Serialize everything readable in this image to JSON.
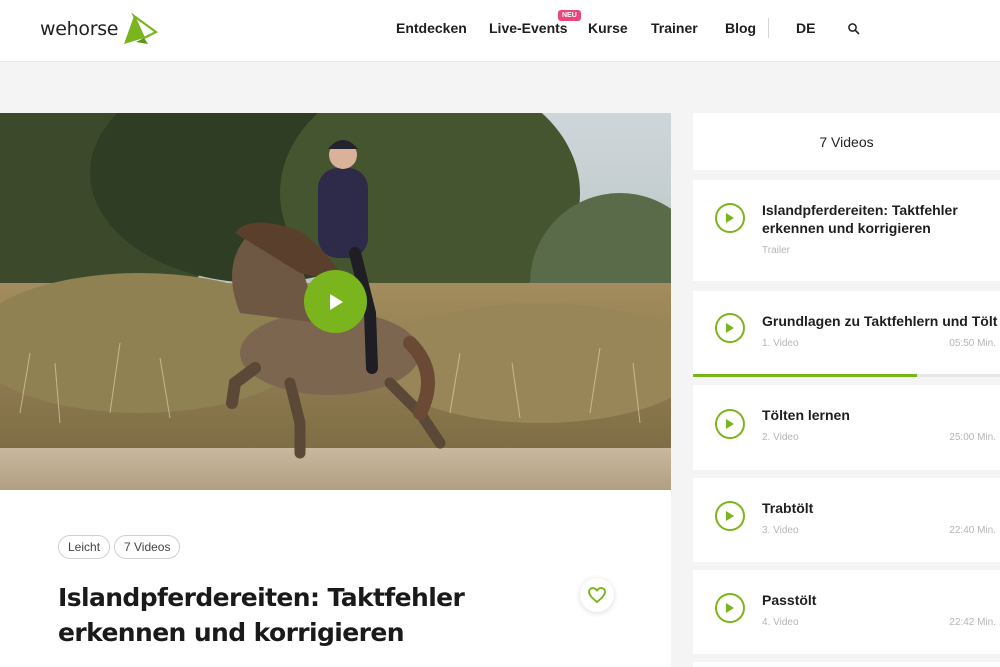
{
  "brand": {
    "name": "wehorse",
    "accent": "#7ab51d",
    "badge_color": "#e8467c"
  },
  "nav": {
    "items": [
      "Entdecken",
      "Live-Events",
      "Kurse",
      "Trainer",
      "Blog"
    ],
    "badge": "NEU",
    "language": "DE",
    "search_icon": "search-icon"
  },
  "course": {
    "tags": [
      "Leicht",
      "7 Videos"
    ],
    "title": "Islandpferdereiten: Taktfehler erkennen und korrigieren",
    "favorite_icon": "heart-icon"
  },
  "playlist": {
    "count_label": "7 Videos",
    "items": [
      {
        "title_line1": "Islandpferdereiten: Taktfehler",
        "title_line2": "erkennen und korrigieren",
        "sub": "Trailer",
        "duration": ""
      },
      {
        "title_line1": "Grundlagen zu Taktfehlern und Tölt",
        "title_line2": "",
        "sub": "1. Video",
        "duration": "05:50 Min.",
        "progress": 0.73
      },
      {
        "title_line1": "Tölten lernen",
        "title_line2": "",
        "sub": "2. Video",
        "duration": "25:00 Min."
      },
      {
        "title_line1": "Trabtölt",
        "title_line2": "",
        "sub": "3. Video",
        "duration": "22:40 Min."
      },
      {
        "title_line1": "Passtölt",
        "title_line2": "",
        "sub": "4. Video",
        "duration": "22:42 Min."
      }
    ]
  }
}
